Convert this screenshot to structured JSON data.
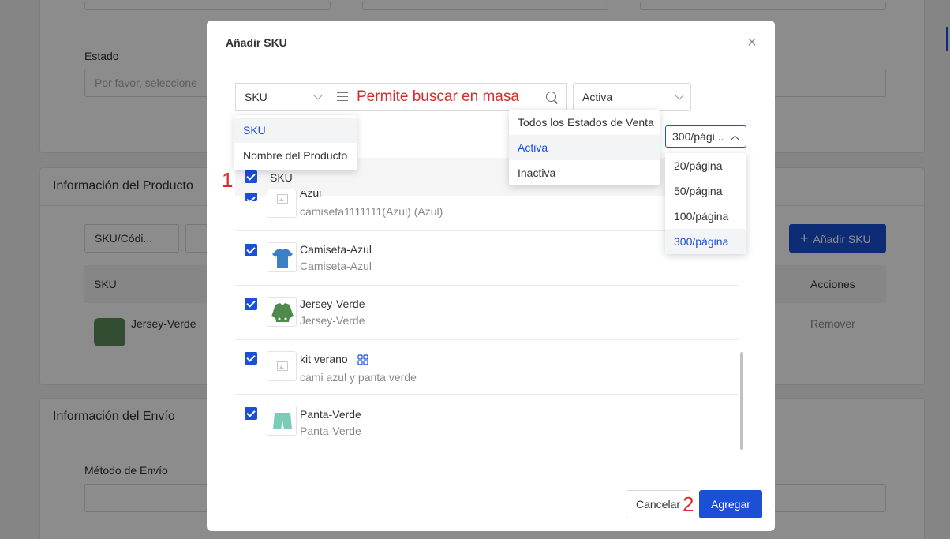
{
  "background": {
    "estado_label": "Estado",
    "estado_placeholder": "Por favor, seleccione",
    "product_section_title": "Información del Producto",
    "sku_code_select": "SKU/Códi...",
    "add_sku_button": "Añadir SKU",
    "table_col_sku": "SKU",
    "table_col_actions": "Acciones",
    "row_name": "Jersey-Verde",
    "row_action": "Remover",
    "shipping_section_title": "Información del Envío",
    "shipping_method_label": "Método de Envío"
  },
  "modal": {
    "title": "Añadir SKU",
    "search_type": {
      "selected": "SKU",
      "options": [
        {
          "label": "SKU",
          "active": true
        },
        {
          "label": "Nombre del Producto",
          "active": false
        }
      ]
    },
    "search_hint": "Permite buscar en masa",
    "status_filter": {
      "selected": "Activa",
      "options": [
        {
          "label": "Todos los Estados de Venta",
          "active": false
        },
        {
          "label": "Activa",
          "active": true
        },
        {
          "label": "Inactiva",
          "active": false
        }
      ]
    },
    "page_size": {
      "selected": "300/pági...",
      "options": [
        {
          "label": "20/página",
          "active": false
        },
        {
          "label": "50/página",
          "active": false
        },
        {
          "label": "100/página",
          "active": false
        },
        {
          "label": "300/página",
          "active": true
        }
      ]
    },
    "table_header": "SKU",
    "annotation_1": "1",
    "annotation_2": "2",
    "rows": [
      {
        "name": "Azul",
        "sub": "camiseta1111111(Azul) (Azul)",
        "image": "placeholder-icon",
        "checked": true
      },
      {
        "name": "Camiseta-Azul",
        "sub": "Camiseta-Azul",
        "image": "tshirt-blue-icon",
        "checked": true
      },
      {
        "name": "Jersey-Verde",
        "sub": "Jersey-Verde",
        "image": "jersey-green-icon",
        "checked": true
      },
      {
        "name": "kit verano",
        "sub": "cami azul y panta verde",
        "image": "placeholder-icon",
        "checked": true,
        "combo": true
      },
      {
        "name": "Panta-Verde",
        "sub": "Panta-Verde",
        "image": "shorts-green-icon",
        "checked": true
      }
    ],
    "cancel_label": "Cancelar",
    "add_label": "Agregar"
  },
  "colors": {
    "primary": "#1b4fd6",
    "annotation": "#d92b2b"
  }
}
